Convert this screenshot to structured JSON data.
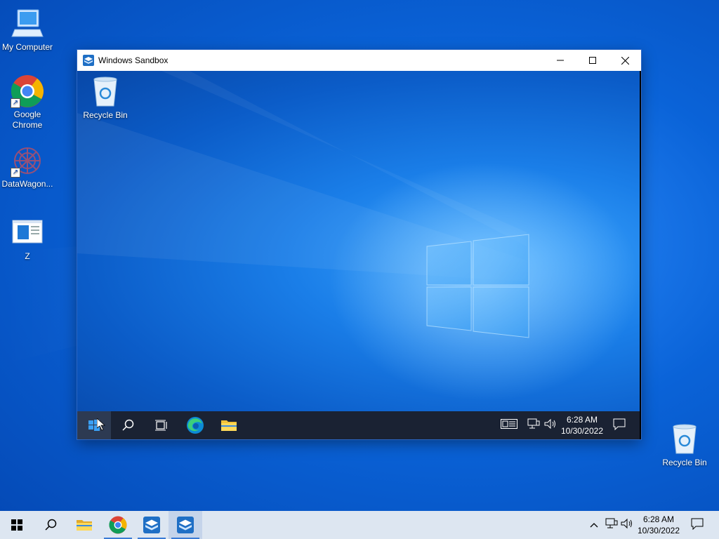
{
  "desktop": {
    "icons": [
      {
        "label": "My Computer",
        "icon": "computer-icon"
      },
      {
        "label": "Google Chrome",
        "icon": "chrome-icon",
        "shortcut": true
      },
      {
        "label": "DataWagon...",
        "icon": "datawagon-icon",
        "shortcut": true
      },
      {
        "label": "Z",
        "icon": "document-window-icon"
      },
      {
        "label": "Recycle Bin",
        "icon": "recycle-bin-icon"
      }
    ]
  },
  "sandbox_window": {
    "title": "Windows Sandbox",
    "controls": {
      "minimize": "minimize-icon",
      "maximize": "maximize-icon",
      "close": "close-icon"
    },
    "inner_desktop": {
      "icons": [
        {
          "label": "Recycle Bin",
          "icon": "recycle-bin-icon"
        }
      ]
    },
    "inner_taskbar": {
      "time": "6:28 AM",
      "date": "10/30/2022",
      "items": [
        "start",
        "search",
        "task-view",
        "edge",
        "file-explorer"
      ]
    }
  },
  "taskbar": {
    "time": "6:28 AM",
    "date": "10/30/2022",
    "items": [
      "start",
      "search",
      "file-explorer",
      "chrome",
      "windows-sandbox",
      "windows-sandbox"
    ]
  },
  "colors": {
    "accent": "#0a63d8",
    "taskbar": "#dde6f1",
    "inner_taskbar": "#1a2233"
  }
}
